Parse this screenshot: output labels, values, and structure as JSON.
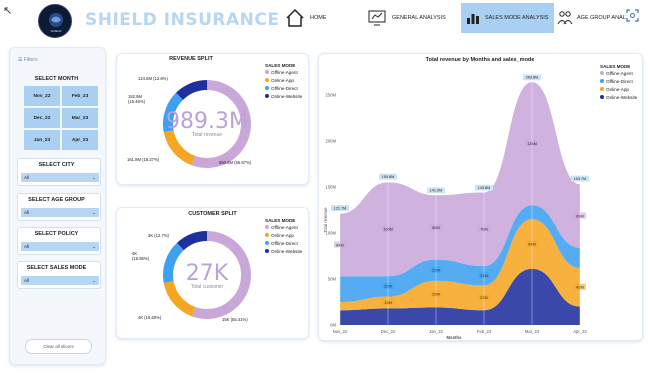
{
  "header": {
    "back_icon": "↖",
    "brand": "SHIELD INSURANCE",
    "nav": [
      {
        "label": "HOME",
        "icon": "home-icon"
      },
      {
        "label": "GENERAL ANALYSIS",
        "icon": "monitor-analysis-icon"
      },
      {
        "label": "SALES MODE ANALYSIS",
        "icon": "bar-chart-icon"
      },
      {
        "label": "AGE GROUP ANALYSIS",
        "icon": "people-icon"
      }
    ],
    "focus_icon": "focus-icon"
  },
  "filters": {
    "heading": "Filters",
    "select_month": "SELECT MONTH",
    "months": [
      "Nov_22",
      "Feb_23",
      "Dec_22",
      "Mar_23",
      "Jan_23",
      "Apr_23"
    ],
    "select_city": "SELECT CITY",
    "city_value": "All",
    "select_age_group": "SELECT AGE GROUP",
    "age_value": "All",
    "select_policy": "SELECT POLICY",
    "policy_value": "All",
    "select_sales_mode": "SELECT SALES MODE",
    "sales_mode_value": "All",
    "clear_label": "Clear all slicers"
  },
  "revenue_split": {
    "title": "REVENUE SPLIT",
    "center_value": "989.3M",
    "center_label": "Total revenue",
    "legend_title": "SALES MODE",
    "labels": [
      "124.6M (12.6%)",
      "152.9M (15.46%)",
      "161.8M (16.27%)",
      "550.8M (55.67%)"
    ]
  },
  "customer_split": {
    "title": "CUSTOMER SPLIT",
    "center_value": "27K",
    "center_label": "Total customer",
    "legend_title": "SALES MODE",
    "labels": [
      "3K (12.7%)",
      "4K (15.86%)",
      "4K (16.60%)",
      "15K (55.41%)"
    ]
  },
  "legend": [
    {
      "label": "Offline-Agent",
      "color": "#c9a7d9"
    },
    {
      "label": "Online-App",
      "color": "#f5a623"
    },
    {
      "label": "Offline-Direct",
      "color": "#3fa0f0"
    },
    {
      "label": "Online-Website",
      "color": "#1f2f9e"
    }
  ],
  "trend": {
    "title": "Total revenue by Months and sales_mode",
    "xlabel": "Months",
    "ylabel": "Total revenue",
    "legend_title": "SALES MODE",
    "legend": [
      {
        "label": "Offline-Agent",
        "color": "#c9a7d9"
      },
      {
        "label": "Offline-Direct",
        "color": "#3fa0f0"
      },
      {
        "label": "Online-App",
        "color": "#f5a623"
      },
      {
        "label": "Online-Website",
        "color": "#1f2f9e"
      }
    ]
  },
  "chart_data": {
    "type": "area",
    "title": "Total revenue by Months and sales_mode",
    "xlabel": "Months",
    "ylabel": "Total revenue",
    "categories": [
      "Nov_22",
      "Dec_22",
      "Jan_23",
      "Feb_23",
      "Mar_23",
      "Apr_23"
    ],
    "ytick_labels": [
      "0M",
      "50M",
      "100M",
      "150M",
      "200M",
      "250M"
    ],
    "ylim": [
      0,
      275
    ],
    "totals": [
      121.7,
      155.8,
      141.0,
      143.8,
      263.8,
      153.7
    ],
    "total_labels": [
      "121.7M",
      "155.8M",
      "141.0M",
      "143.8M",
      "263.8M",
      "153.7M"
    ],
    "series": [
      {
        "name": "Online-Website",
        "values": [
          16,
          18,
          19,
          16,
          61,
          20
        ],
        "labels": [
          "",
          "",
          "",
          "",
          "",
          ""
        ]
      },
      {
        "name": "Online-App",
        "values": [
          9,
          13,
          29,
          27,
          54,
          42
        ],
        "labels": [
          "",
          "13M",
          "29M",
          "27M",
          "54M",
          "42M"
        ]
      },
      {
        "name": "Offline-Direct",
        "values": [
          28,
          22,
          23,
          21,
          15,
          22
        ],
        "labels": [
          "",
          "22M",
          "23M",
          "21M",
          "",
          ""
        ]
      },
      {
        "name": "Offline-Agent",
        "values": [
          68,
          102,
          70,
          80,
          134,
          69
        ],
        "labels": [
          "",
          "",
          "",
          "",
          "",
          ""
        ]
      }
    ],
    "series_labels_extra": {
      "Offline-Agent": [
        "84M",
        "100M",
        "85M",
        "76M",
        "134M",
        "69M"
      ]
    },
    "legend_position": "top-right"
  }
}
